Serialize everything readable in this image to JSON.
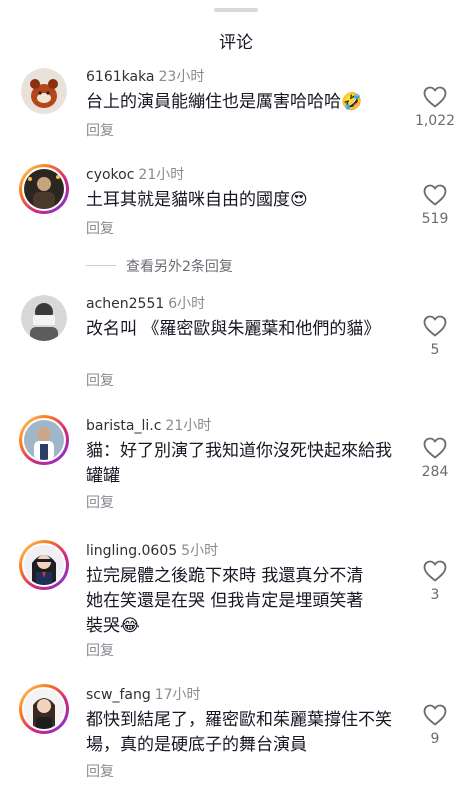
{
  "sheet": {
    "title": "评论"
  },
  "comments": [
    {
      "username": "6161kaka",
      "time": "23小时",
      "text": "台上的演員能繃住也是厲害哈哈哈🤣",
      "reply": "回复",
      "likes": "1,022"
    },
    {
      "username": "cyokoc",
      "time": "21小时",
      "text": "土耳其就是貓咪自由的國度😍",
      "reply": "回复",
      "likes": "519"
    },
    {
      "username": "achen2551",
      "time": "6小时",
      "text": "改名叫 《羅密歐與朱麗葉和他們的貓》",
      "reply": "回复",
      "likes": "5"
    },
    {
      "username": "barista_li.c",
      "time": "21小时",
      "text": "貓：好了別演了我知道你沒死快起來給我罐罐",
      "reply": "回复",
      "likes": "284"
    },
    {
      "username": "lingling.0605",
      "time": "5小时",
      "text": "拉完屍體之後跪下來時 我還真分不清她在笑還是在哭 但我肯定是埋頭笑著裝哭😂",
      "reply": "回复",
      "likes": "3"
    },
    {
      "username": "scw_fang",
      "time": "17小时",
      "text": "都快到結尾了，羅密歐和茱麗葉撐住不笑場，真的是硬底子的舞台演員",
      "reply": "回复",
      "likes": "9"
    }
  ],
  "view_more": {
    "label": "查看另外2条回复"
  },
  "icons": {
    "like": "heart-outline-icon"
  },
  "colors": {
    "story_ring": "#d62976",
    "text_primary": "#161823",
    "text_secondary": "#8a8b91"
  }
}
